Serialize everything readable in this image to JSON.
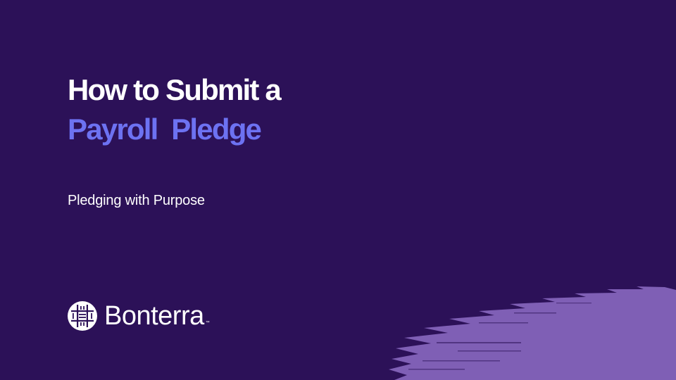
{
  "slide": {
    "title_line_1": "How to Submit a",
    "title_line_2": "Payroll  Pledge",
    "subtitle": "Pledging with Purpose"
  },
  "brand": {
    "logo_text": "Bonterra",
    "trademark": "™",
    "icon": "bonterra-woven-logo-icon"
  },
  "colors": {
    "background": "#2c1158",
    "title_primary": "#ffffff",
    "title_accent": "#6d72f2",
    "brush_accent": "#7f5fb5"
  }
}
